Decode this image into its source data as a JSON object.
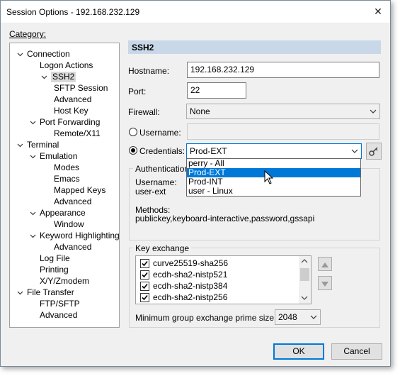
{
  "window": {
    "title": "Session Options - 192.168.232.129",
    "close_glyph": "✕"
  },
  "category_label": "Category:",
  "tree": [
    {
      "label": "Connection"
    },
    {
      "label": "Logon Actions"
    },
    {
      "label": "SSH2",
      "selected": true
    },
    {
      "label": "SFTP Session"
    },
    {
      "label": "Advanced"
    },
    {
      "label": "Host Key"
    },
    {
      "label": "Port Forwarding"
    },
    {
      "label": "Remote/X11"
    },
    {
      "label": "Terminal"
    },
    {
      "label": "Emulation"
    },
    {
      "label": "Modes"
    },
    {
      "label": "Emacs"
    },
    {
      "label": "Mapped Keys"
    },
    {
      "label": "Advanced"
    },
    {
      "label": "Appearance"
    },
    {
      "label": "Window"
    },
    {
      "label": "Keyword Highlighting"
    },
    {
      "label": "Advanced"
    },
    {
      "label": "Log File"
    },
    {
      "label": "Printing"
    },
    {
      "label": "X/Y/Zmodem"
    },
    {
      "label": "File Transfer"
    },
    {
      "label": "FTP/SFTP"
    },
    {
      "label": "Advanced"
    }
  ],
  "section_title": "SSH2",
  "hostname": {
    "label": "Hostname:",
    "value": "192.168.232.129"
  },
  "port": {
    "label": "Port:",
    "value": "22"
  },
  "firewall": {
    "label": "Firewall:",
    "value": "None"
  },
  "username": {
    "label": "Username:",
    "value": ""
  },
  "credentials": {
    "label": "Credentials:",
    "value": "Prod-EXT",
    "selected": true
  },
  "credentials_options": [
    "perry - All",
    "Prod-EXT",
    "Prod-INT",
    "user - Linux"
  ],
  "credentials_highlighted": "Prod-EXT",
  "auth": {
    "title": "Authentication",
    "username_label": "Username:",
    "username_value": "user-ext",
    "methods_label": "Methods:",
    "methods_value": "publickey,keyboard-interactive,password,gssapi"
  },
  "key_exchange": {
    "title": "Key exchange",
    "items": [
      {
        "label": "curve25519-sha256",
        "checked": true
      },
      {
        "label": "ecdh-sha2-nistp521",
        "checked": true
      },
      {
        "label": "ecdh-sha2-nistp384",
        "checked": true
      },
      {
        "label": "ecdh-sha2-nistp256",
        "checked": true
      }
    ],
    "min_group_label": "Minimum group exchange prime size:",
    "min_group_value": "2048"
  },
  "buttons": {
    "ok": "OK",
    "cancel": "Cancel"
  }
}
